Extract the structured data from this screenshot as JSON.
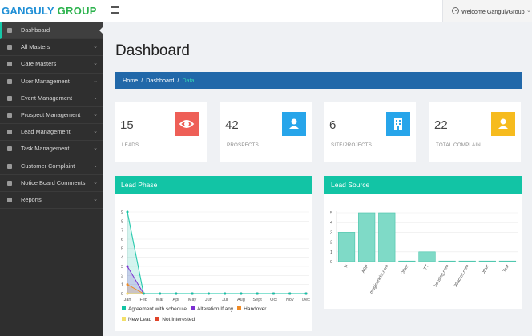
{
  "header": {
    "logo_part1": "GANGULY",
    "logo_part2": "GROUP",
    "welcome_text": "Welcome GangulyGroup"
  },
  "sidebar": {
    "items": [
      {
        "label": "Dashboard",
        "icon": "dashboard-icon",
        "active": true
      },
      {
        "label": "All Masters",
        "icon": "building-icon"
      },
      {
        "label": "Care Masters",
        "icon": "building-icon"
      },
      {
        "label": "User Management",
        "icon": "users-icon"
      },
      {
        "label": "Event Management",
        "icon": "users-icon"
      },
      {
        "label": "Prospect Management",
        "icon": "users-icon"
      },
      {
        "label": "Lead Management",
        "icon": "building-icon"
      },
      {
        "label": "Task Management",
        "icon": "user-icon"
      },
      {
        "label": "Customer Complaint",
        "icon": "flag-icon"
      },
      {
        "label": "Notice Board Comments",
        "icon": "flag-icon"
      },
      {
        "label": "Reports",
        "icon": "flag-icon"
      }
    ]
  },
  "page": {
    "title": "Dashboard",
    "breadcrumb": [
      "Home",
      "Dashboard",
      "Data"
    ]
  },
  "cards": [
    {
      "value": "15",
      "label": "LEADS",
      "color": "#ee5f57",
      "icon": "eye-icon"
    },
    {
      "value": "42",
      "label": "PROSPECTS",
      "color": "#27a5ea",
      "icon": "user-icon"
    },
    {
      "value": "6",
      "label": "SITE/PROJECTS",
      "color": "#27a5ea",
      "icon": "building-icon"
    },
    {
      "value": "22",
      "label": "TOTAL COMPLAIN",
      "color": "#f6bb1e",
      "icon": "user-icon"
    }
  ],
  "panels": {
    "lead_phase_title": "Lead Phase",
    "lead_source_title": "Lead Source"
  },
  "colors": {
    "accent": "#12c4a5",
    "breadcrumb": "#2168a9",
    "sidebar": "#2f2f2f"
  },
  "chart_data": [
    {
      "type": "line",
      "categories": [
        "Jan",
        "Feb",
        "Mar",
        "Apr",
        "May",
        "Jun",
        "Jul",
        "Aug",
        "Sept",
        "Oct",
        "Nov",
        "Dec"
      ],
      "y_ticks": [
        0,
        1,
        2,
        3,
        4,
        5,
        6,
        7,
        8,
        9
      ],
      "ylim": [
        0,
        9
      ],
      "grid": "y",
      "series": [
        {
          "name": "Agreement with schedule",
          "color": "#12c4a5",
          "values": [
            9,
            0,
            0,
            0,
            0,
            0,
            0,
            0,
            0,
            0,
            0,
            0
          ]
        },
        {
          "name": "Alteration If any",
          "color": "#7b2fd1",
          "values": [
            3,
            0,
            0,
            0,
            0,
            0,
            0,
            0,
            0,
            0,
            0,
            0
          ]
        },
        {
          "name": "Handover",
          "color": "#f08a24",
          "values": [
            1,
            0,
            0,
            0,
            0,
            0,
            0,
            0,
            0,
            0,
            0,
            0
          ]
        },
        {
          "name": "New Lead",
          "color": "#f3e06a",
          "values": [
            0,
            0,
            0,
            0,
            0,
            0,
            0,
            0,
            0,
            0,
            0,
            0
          ]
        },
        {
          "name": "Not Interested",
          "color": "#e0442a",
          "values": [
            0,
            0,
            0,
            0,
            0,
            0,
            0,
            0,
            0,
            0,
            0,
            0
          ]
        }
      ],
      "legend_position": "bottom"
    },
    {
      "type": "bar",
      "categories": [
        "Ti",
        "ASP",
        "magicbricks.com",
        "Other",
        "TT",
        "housing.com",
        "99acres.com",
        "Other",
        "Test"
      ],
      "values": [
        3,
        5,
        5,
        0,
        1,
        0,
        0,
        0,
        0
      ],
      "y_ticks": [
        0,
        1,
        2,
        3,
        4,
        5
      ],
      "ylim": [
        0,
        5
      ],
      "grid": "y",
      "bar_color": "#7fdac7"
    }
  ]
}
